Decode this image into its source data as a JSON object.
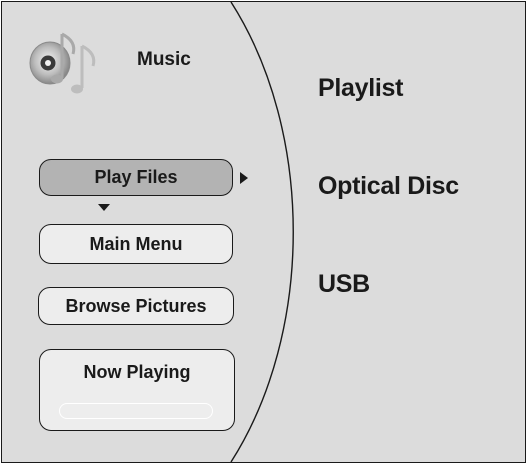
{
  "header": {
    "title": "Music",
    "icon": "music-notes-disc-icon"
  },
  "left_menu": {
    "buttons": [
      {
        "label": "Play Files",
        "selected": true
      },
      {
        "label": "Main Menu",
        "selected": false
      },
      {
        "label": "Browse Pictures",
        "selected": false
      }
    ],
    "now_playing": {
      "label": "Now Playing",
      "progress": 0
    }
  },
  "sources": {
    "items": [
      {
        "label": "Playlist"
      },
      {
        "label": "Optical Disc"
      },
      {
        "label": "USB"
      }
    ]
  },
  "colors": {
    "background": "#dcdcdc",
    "button": "#ededed",
    "button_selected": "#b3b3b3",
    "ink": "#1a1a1a"
  }
}
